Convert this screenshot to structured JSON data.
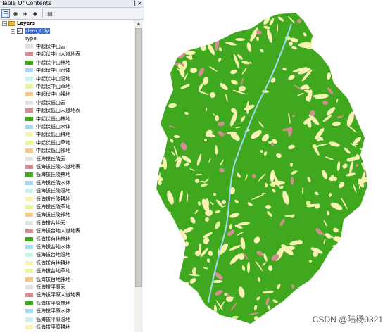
{
  "toc": {
    "title": "Table Of Contents",
    "window_controls": "⌉ ×",
    "toolbar": [
      "list-by-drawing-order-icon",
      "list-by-source-icon",
      "list-by-visibility-icon",
      "list-by-selection-icon",
      "options-icon"
    ],
    "layers_label": "Layers",
    "layer_name": "dem_tdly",
    "field_label": "type",
    "legend": [
      {
        "label": "中起伏中山云",
        "color": "#e1e1e1"
      },
      {
        "label": "中起伏中山人道地表",
        "color": "#d28f8f"
      },
      {
        "label": "中起伏中山林地",
        "color": "#3fa81e"
      },
      {
        "label": "中起伏中山水体",
        "color": "#a8d8f0"
      },
      {
        "label": "中起伏中山湿地",
        "color": "#c6f2ea"
      },
      {
        "label": "中起伏中山草地",
        "color": "#e6f59c"
      },
      {
        "label": "中起伏中山裸地",
        "color": "#f2c98a"
      },
      {
        "label": "中起伏低山云",
        "color": "#e1e1e1"
      },
      {
        "label": "中起伏低山人道地表",
        "color": "#d28f8f"
      },
      {
        "label": "中起伏低山林地",
        "color": "#3fa81e"
      },
      {
        "label": "中起伏低山水体",
        "color": "#a8d8f0"
      },
      {
        "label": "中起伏低山耕地",
        "color": "#f7f3b5"
      },
      {
        "label": "中起伏低山草地",
        "color": "#e6f59c"
      },
      {
        "label": "中起伏低山裸地",
        "color": "#f2c98a"
      },
      {
        "label": "低海拔丘陵云",
        "color": "#e1e1e1"
      },
      {
        "label": "低海拔丘陵人道地表",
        "color": "#d28f8f"
      },
      {
        "label": "低海拔丘陵林地",
        "color": "#3fa81e"
      },
      {
        "label": "低海拔丘陵水体",
        "color": "#a8d8f0"
      },
      {
        "label": "低海拔丘陵湿地",
        "color": "#c6f2ea"
      },
      {
        "label": "低海拔丘陵耕地",
        "color": "#f7f3b5"
      },
      {
        "label": "低海拔丘陵草地",
        "color": "#e6f59c"
      },
      {
        "label": "低海拔丘陵裸地",
        "color": "#f2c98a"
      },
      {
        "label": "低海拔台地云",
        "color": "#e1e1e1"
      },
      {
        "label": "低海拔台地人道地表",
        "color": "#d28f8f"
      },
      {
        "label": "低海拔台地林地",
        "color": "#3fa81e"
      },
      {
        "label": "低海拔台地水体",
        "color": "#a8d8f0"
      },
      {
        "label": "低海拔台地湿地",
        "color": "#c6f2ea"
      },
      {
        "label": "低海拔台地耕地",
        "color": "#f7f3b5"
      },
      {
        "label": "低海拔台地草地",
        "color": "#e6f59c"
      },
      {
        "label": "低海拔台地裸地",
        "color": "#f2c98a"
      },
      {
        "label": "低海拔平原云",
        "color": "#e1e1e1"
      },
      {
        "label": "低海拔平原人道地表",
        "color": "#d28f8f"
      },
      {
        "label": "低海拔平原林地",
        "color": "#3fa81e"
      },
      {
        "label": "低海拔平原水体",
        "color": "#a8d8f0"
      },
      {
        "label": "低海拔平原湿地",
        "color": "#c6f2ea"
      },
      {
        "label": "低海拔平原耕地",
        "color": "#f7f3b5"
      },
      {
        "label": "低海拔平原草地",
        "color": "#e6f59c"
      }
    ]
  },
  "map": {
    "colors": {
      "forest": "#3fa81e",
      "farmland": "#f7f3b5",
      "urban": "#d28f8f",
      "water": "#a8d8f0",
      "grass": "#e6f59c"
    }
  },
  "watermark": "CSDN @陆杨0321"
}
